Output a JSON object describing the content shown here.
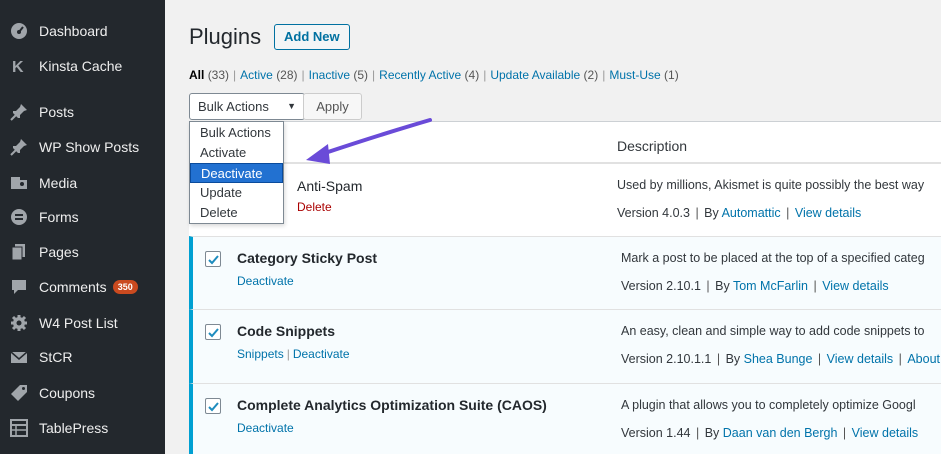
{
  "sidebar": {
    "items": [
      {
        "label": "Dashboard",
        "icon": "dashboard-icon"
      },
      {
        "label": "Kinsta Cache",
        "icon": "kinsta-icon"
      },
      {
        "label": "Posts",
        "icon": "pin-icon"
      },
      {
        "label": "WP Show Posts",
        "icon": "pin-icon"
      },
      {
        "label": "Media",
        "icon": "media-icon"
      },
      {
        "label": "Forms",
        "icon": "forms-icon"
      },
      {
        "label": "Pages",
        "icon": "pages-icon"
      },
      {
        "label": "Comments",
        "icon": "comments-icon",
        "badge": "350"
      },
      {
        "label": "W4 Post List",
        "icon": "gear-icon"
      },
      {
        "label": "StCR",
        "icon": "mail-icon"
      },
      {
        "label": "Coupons",
        "icon": "tag-icon"
      },
      {
        "label": "TablePress",
        "icon": "table-icon"
      }
    ]
  },
  "header": {
    "title": "Plugins",
    "add_new": "Add New"
  },
  "filters": {
    "all": {
      "label": "All",
      "count": "(33)"
    },
    "active": {
      "label": "Active",
      "count": "(28)"
    },
    "inactive": {
      "label": "Inactive",
      "count": "(5)"
    },
    "recently_active": {
      "label": "Recently Active",
      "count": "(4)"
    },
    "update_available": {
      "label": "Update Available",
      "count": "(2)"
    },
    "must_use": {
      "label": "Must-Use",
      "count": "(1)"
    },
    "separator": "|"
  },
  "bulk": {
    "selected": "Bulk Actions",
    "caret": "▼",
    "apply": "Apply",
    "options": [
      "Bulk Actions",
      "Activate",
      "Deactivate",
      "Update",
      "Delete"
    ],
    "highlighted": "Deactivate"
  },
  "table": {
    "description_header": "Description",
    "rows": [
      {
        "name_fragment": "Anti-Spam",
        "action_fragment": "Delete",
        "description": "Used by millions, Akismet is quite possibly the best way",
        "version": "Version 4.0.3",
        "by": "By",
        "author": "Automattic",
        "view_details": "View details"
      },
      {
        "name": "Category Sticky Post",
        "actions": [
          "Deactivate"
        ],
        "description": "Mark a post to be placed at the top of a specified categ",
        "version": "Version 2.10.1",
        "by": "By",
        "author": "Tom McFarlin",
        "view_details": "View details"
      },
      {
        "name": "Code Snippets",
        "actions": [
          "Snippets",
          "Deactivate"
        ],
        "description": "An easy, clean and simple way to add code snippets to",
        "version": "Version 2.10.1.1",
        "by": "By",
        "author": "Shea Bunge",
        "view_details": "View details",
        "extra": "About"
      },
      {
        "name": "Complete Analytics Optimization Suite (CAOS)",
        "actions": [
          "Deactivate"
        ],
        "description": "A plugin that allows you to completely optimize Googl",
        "version": "Version 1.44",
        "by": "By",
        "author": "Daan van den Bergh",
        "view_details": "View details"
      }
    ]
  },
  "colors": {
    "sidebar_bg": "#23282d",
    "link": "#0073aa",
    "active_border": "#00a0d2",
    "badge": "#ca4a1f",
    "arrow": "#6a4bd8",
    "highlight": "#2271d1"
  }
}
